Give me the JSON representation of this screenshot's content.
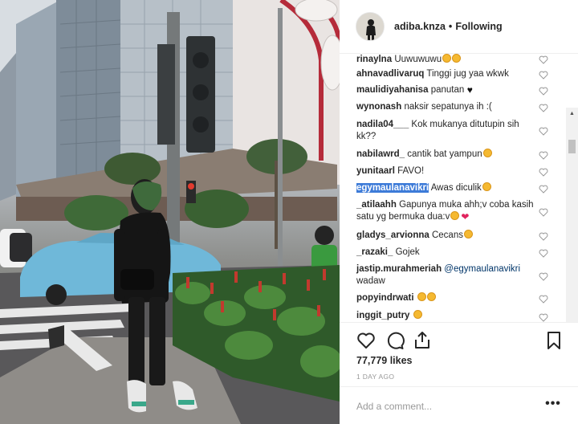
{
  "post": {
    "username": "adiba.knza",
    "separator": "•",
    "follow_status": "Following",
    "likes": "77,779 likes",
    "timestamp": "1 DAY AGO"
  },
  "comments": [
    {
      "user": "rinaylna",
      "text": "Uuwuwuwu",
      "emoji": [
        "y",
        "y"
      ]
    },
    {
      "user": "ahnavadlivaruq",
      "text": "Tinggi jug yaa wkwk",
      "emoji": []
    },
    {
      "user": "maulidiyahanisa",
      "text": "panutan",
      "emoji": [
        "hb"
      ]
    },
    {
      "user": "wynonash",
      "text": "naksir sepatunya ih :(",
      "emoji": []
    },
    {
      "user": "nadila04___",
      "text": "Kok mukanya ditutupin sih kk??",
      "emoji": []
    },
    {
      "user": "nabilawrd_",
      "text": "cantik bat yampun",
      "emoji": [
        "y"
      ]
    },
    {
      "user": "yunitaarl",
      "text": "FAVO!",
      "emoji": []
    },
    {
      "user": "egymaulanavikri",
      "text": "Awas diculik",
      "emoji": [
        "y"
      ],
      "highlight": true
    },
    {
      "user": "_atilaahh",
      "text": "Gapunya muka ahh;v coba kasih satu yg bermuka dua:v",
      "emoji": [
        "y",
        "hv"
      ]
    },
    {
      "user": "gladys_arvionna",
      "text": "Cecans",
      "emoji": [
        "y"
      ]
    },
    {
      "user": "_razaki_",
      "text": "Gojek",
      "emoji": []
    },
    {
      "user": "jastip.murahmeriah",
      "mention": "@egymaulanavikri",
      "text": "wadaw",
      "emoji": []
    },
    {
      "user": "popyindrwati",
      "text": "",
      "emoji": [
        "y",
        "y"
      ]
    },
    {
      "user": "inggit_putry",
      "text": "",
      "emoji": [
        "y"
      ]
    }
  ],
  "comment_input": {
    "placeholder": "Add a comment..."
  },
  "icons": {
    "like": "heart-outline-icon",
    "comment": "comment-bubble-icon",
    "share": "share-icon",
    "save": "bookmark-icon",
    "more": "more-options-icon"
  },
  "colors": {
    "text": "#262626",
    "muted": "#999999",
    "highlight": "#3d7bd8",
    "like_red": "#e0245e"
  }
}
